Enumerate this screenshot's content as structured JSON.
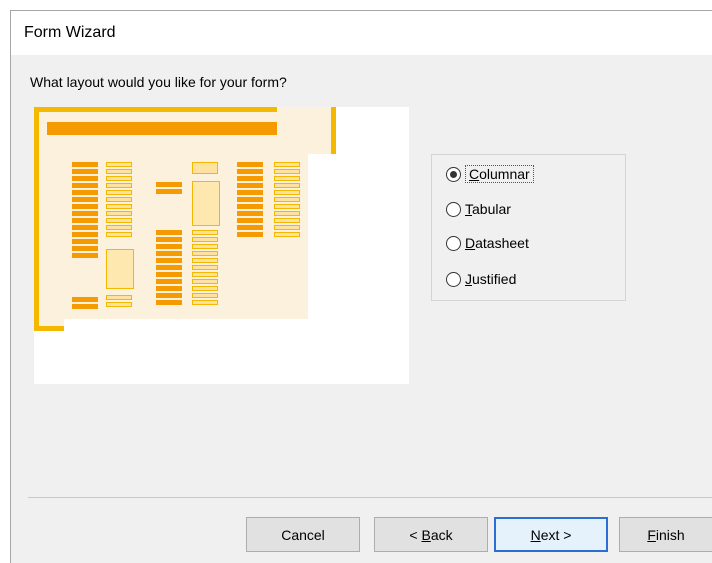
{
  "window": {
    "title": "Form Wizard"
  },
  "prompt": "What layout would you like for your form?",
  "layout_options": {
    "selected": "Columnar",
    "items": [
      {
        "label": "Columnar",
        "mnemonic": "C",
        "rest": "olumnar",
        "selected": true
      },
      {
        "label": "Tabular",
        "mnemonic": "T",
        "rest": "abular",
        "selected": false
      },
      {
        "label": "Datasheet",
        "mnemonic": "D",
        "rest": "atasheet",
        "selected": false
      },
      {
        "label": "Justified",
        "mnemonic": "J",
        "rest": "ustified",
        "selected": false
      }
    ]
  },
  "buttons": {
    "cancel": "Cancel",
    "back_prefix": "< ",
    "back_mnemonic": "B",
    "back_rest": "ack",
    "next_mnemonic": "N",
    "next_rest": "ext >",
    "finish_mnemonic": "F",
    "finish_rest": "inish"
  },
  "colors": {
    "accent": "#f5b800",
    "label_bar": "#f59a00",
    "preview_bg": "#fbf1dd",
    "default_button_border": "#2a6fd6"
  }
}
